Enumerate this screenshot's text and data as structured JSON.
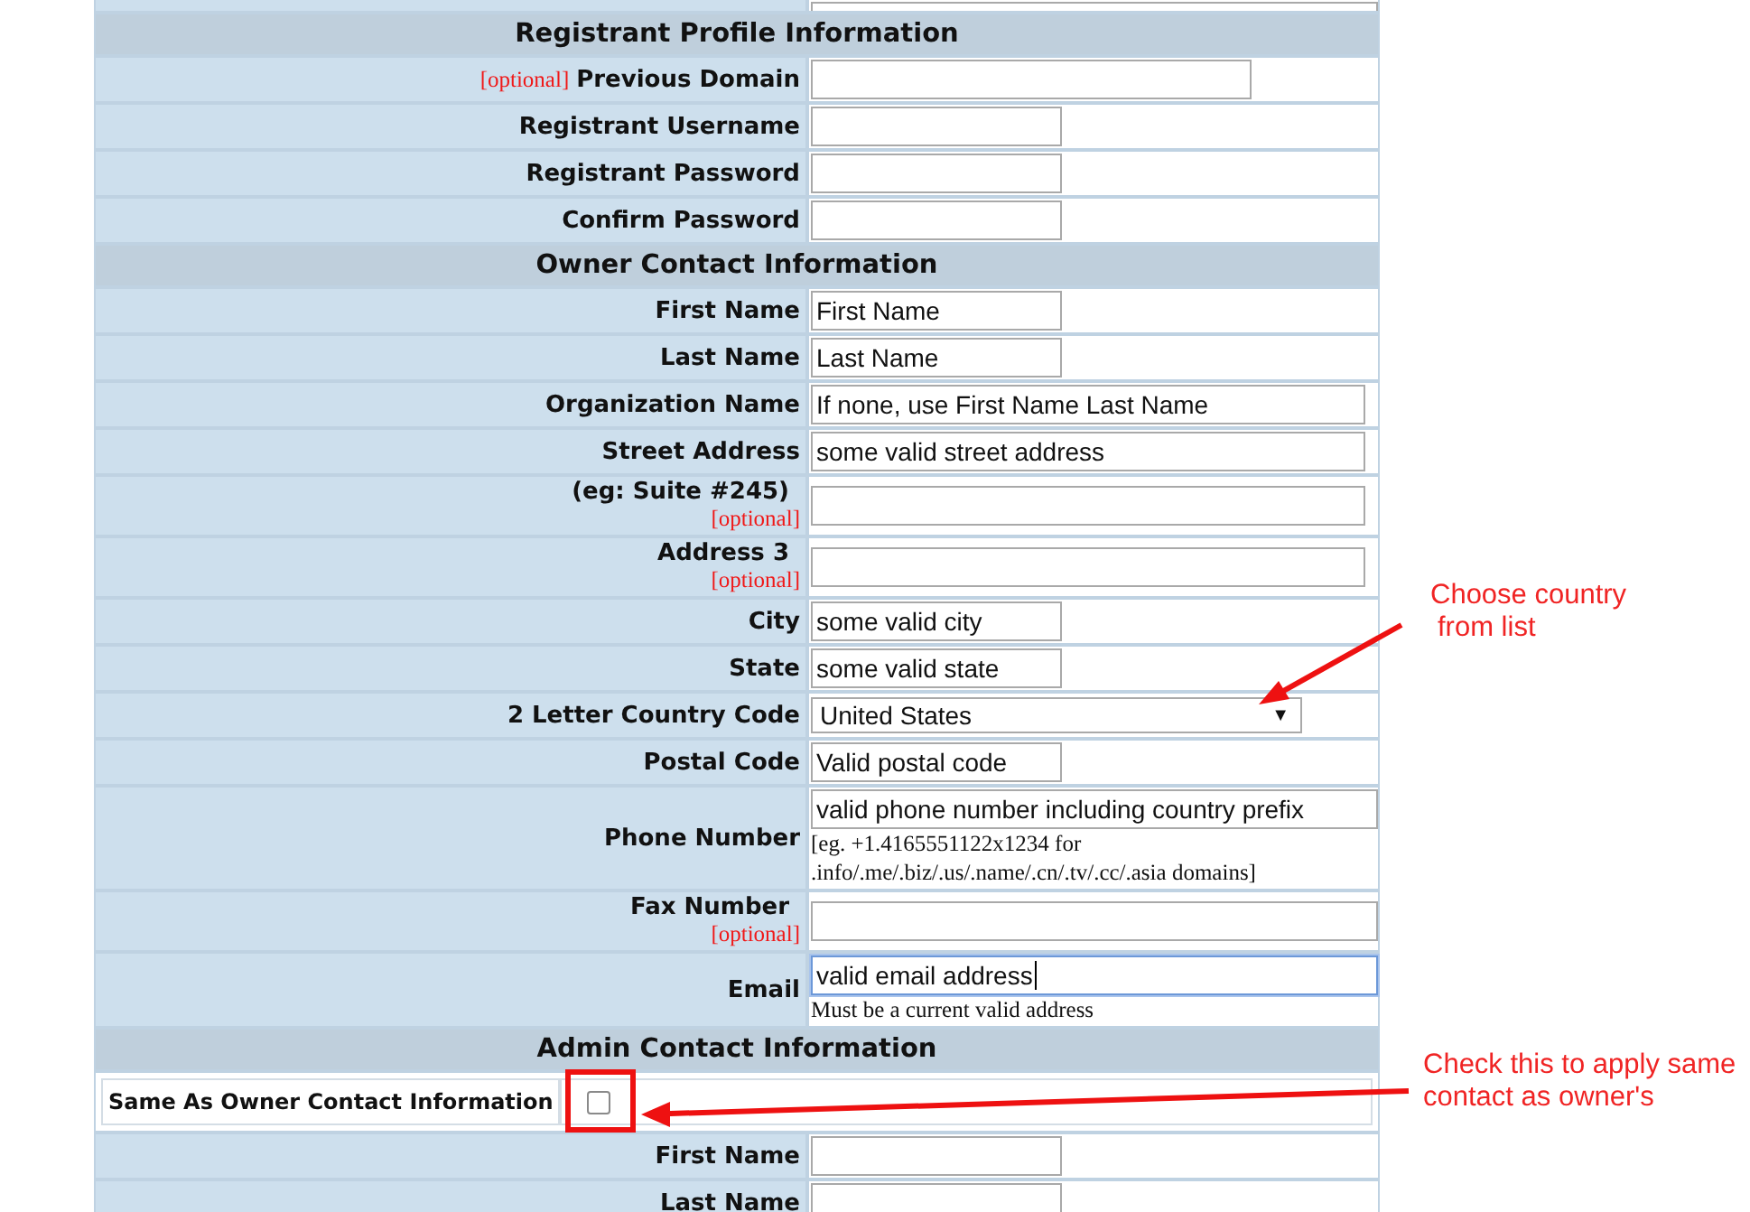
{
  "top_row": {
    "kind": "field"
  },
  "sections": [
    {
      "title": "Registrant Profile Information",
      "rows": [
        {
          "kind": "field",
          "label": "Previous Domain",
          "prefix": "[optional]"
        },
        {
          "kind": "field",
          "label": "Registrant Username"
        },
        {
          "kind": "field",
          "label": "Registrant Password"
        },
        {
          "kind": "field",
          "label": "Confirm Password"
        }
      ]
    },
    {
      "title": "Owner Contact Information",
      "rows": [
        {
          "kind": "field",
          "label": "First Name",
          "value": "First Name"
        },
        {
          "kind": "field",
          "label": "Last Name",
          "value": "Last Name"
        },
        {
          "kind": "field",
          "label": "Organization Name",
          "value": "If none, use First Name Last Name"
        },
        {
          "kind": "field",
          "label": "Street Address",
          "value": "some valid street address"
        },
        {
          "kind": "field",
          "label": "(eg: Suite #245)",
          "note": "[optional]"
        },
        {
          "kind": "field",
          "label": "Address 3",
          "note": "[optional]"
        },
        {
          "kind": "field",
          "label": "City",
          "value": "some valid city"
        },
        {
          "kind": "field",
          "label": "State",
          "value": "some valid state"
        },
        {
          "kind": "select",
          "label": "2 Letter Country Code",
          "value": "United States",
          "arrow": "▼"
        },
        {
          "kind": "field",
          "label": "Postal Code",
          "value": "Valid postal code"
        },
        {
          "kind": "field",
          "label": "Phone Number",
          "value": "valid phone number including country prefix",
          "hint": "[eg. +1.4165551122x1234 for .info/.me/.biz/.us/.name/.cn/.tv/.cc/.asia domains]"
        },
        {
          "kind": "field",
          "label": "Fax Number",
          "note": "[optional]"
        },
        {
          "kind": "field",
          "label": "Email",
          "value": "valid email address",
          "hint": "Must be a current valid address",
          "focused": true
        }
      ]
    },
    {
      "title": "Admin Contact Information",
      "rows": [
        {
          "kind": "checkbox",
          "label": "Same As Owner Contact Information",
          "checked": false
        },
        {
          "kind": "field",
          "label": "First Name"
        },
        {
          "kind": "field",
          "label": "Last Name"
        }
      ]
    }
  ],
  "annotations": [
    {
      "kind": "country",
      "lines": [
        "Choose country",
        "from list"
      ]
    },
    {
      "kind": "checkbox",
      "lines": [
        "Check this to apply same",
        "contact as owner's"
      ]
    }
  ]
}
